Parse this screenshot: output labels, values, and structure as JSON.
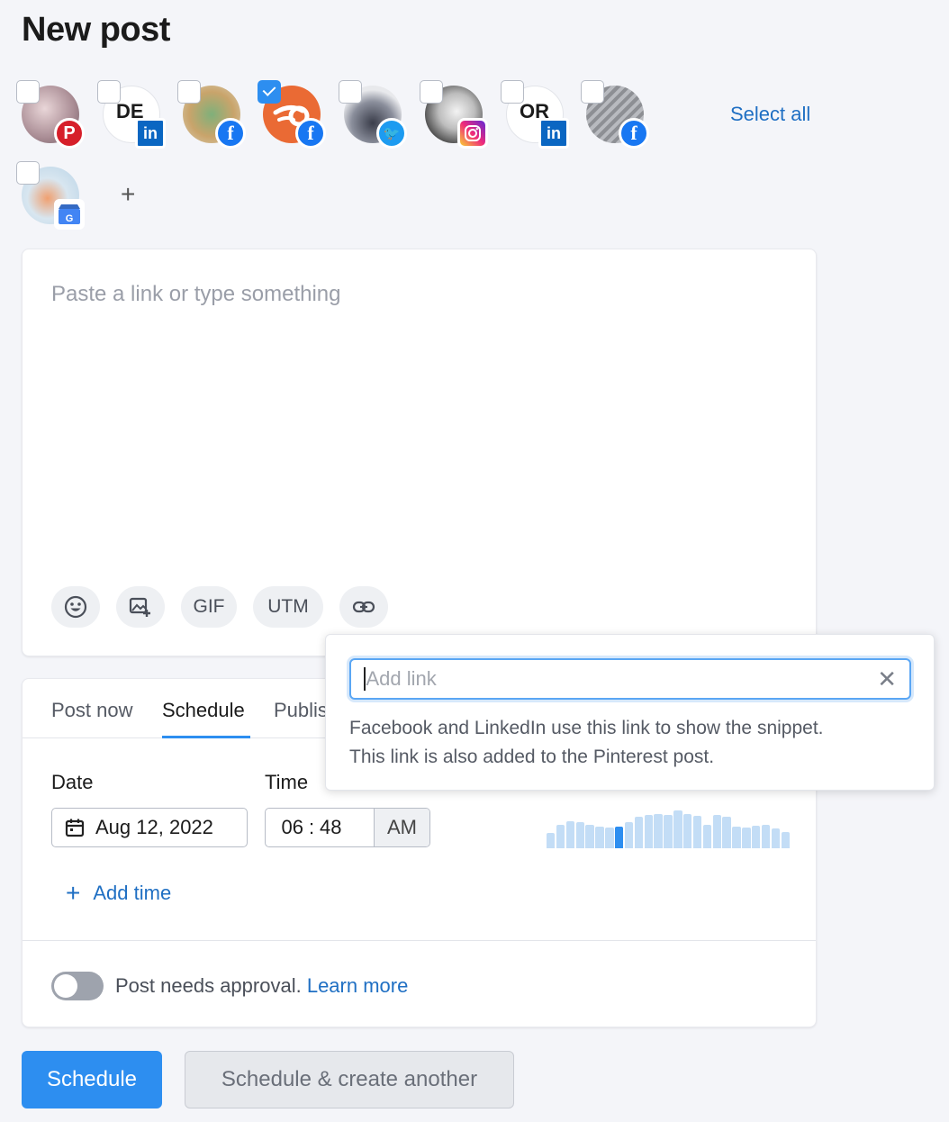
{
  "page": {
    "title": "New post"
  },
  "accounts": [
    {
      "id": "a1",
      "network": "pinterest",
      "badge_glyph": "P",
      "initials": "",
      "checked": false
    },
    {
      "id": "a2",
      "network": "linkedin",
      "badge_glyph": "in",
      "initials": "DE",
      "checked": false
    },
    {
      "id": "a3",
      "network": "facebook",
      "badge_glyph": "f",
      "initials": "",
      "checked": false
    },
    {
      "id": "a4",
      "network": "facebook",
      "badge_glyph": "f",
      "initials": "",
      "checked": true
    },
    {
      "id": "a5",
      "network": "twitter",
      "badge_glyph": "🐦",
      "initials": "",
      "checked": false
    },
    {
      "id": "a6",
      "network": "instagram",
      "badge_glyph": "",
      "initials": "",
      "checked": false
    },
    {
      "id": "a7",
      "network": "linkedin",
      "badge_glyph": "in",
      "initials": "OR",
      "checked": false
    },
    {
      "id": "a8",
      "network": "facebook",
      "badge_glyph": "f",
      "initials": "",
      "checked": false
    },
    {
      "id": "a9",
      "network": "google-my-business",
      "badge_glyph": "G",
      "initials": "",
      "checked": false
    }
  ],
  "select_all_label": "Select all",
  "add_account_label": "+",
  "editor": {
    "placeholder": "Paste a link or type something",
    "tools": {
      "gif": "GIF",
      "utm": "UTM"
    }
  },
  "schedule": {
    "tabs": [
      "Post now",
      "Schedule",
      "Publis"
    ],
    "active_tab": "Schedule",
    "date_label": "Date",
    "time_label": "Time",
    "date_value": "Aug 12, 2022",
    "time": {
      "hour": "06",
      "sep": ":",
      "minute": "48",
      "ampm": "AM"
    },
    "add_time_label": "Add time",
    "approval_text": "Post needs approval.",
    "learn_more": "Learn more",
    "approval_enabled": false,
    "activity_levels": [
      0.35,
      0.55,
      0.62,
      0.6,
      0.55,
      0.5,
      0.48,
      0.5,
      0.6,
      0.72,
      0.78,
      0.8,
      0.78,
      0.88,
      0.8,
      0.75,
      0.55,
      0.78,
      0.72,
      0.5,
      0.48,
      0.52,
      0.55,
      0.45,
      0.38
    ],
    "selected_bar": 7
  },
  "buttons": {
    "primary": "Schedule",
    "secondary": "Schedule & create another"
  },
  "link_popover": {
    "placeholder": "Add link",
    "help_line1": "Facebook and LinkedIn use this link to show the snippet.",
    "help_line2": "This link is also added to the Pinterest post."
  },
  "colors": {
    "accent": "#2d8ef0",
    "link": "#1f6fc3",
    "background": "#f4f5f9"
  }
}
